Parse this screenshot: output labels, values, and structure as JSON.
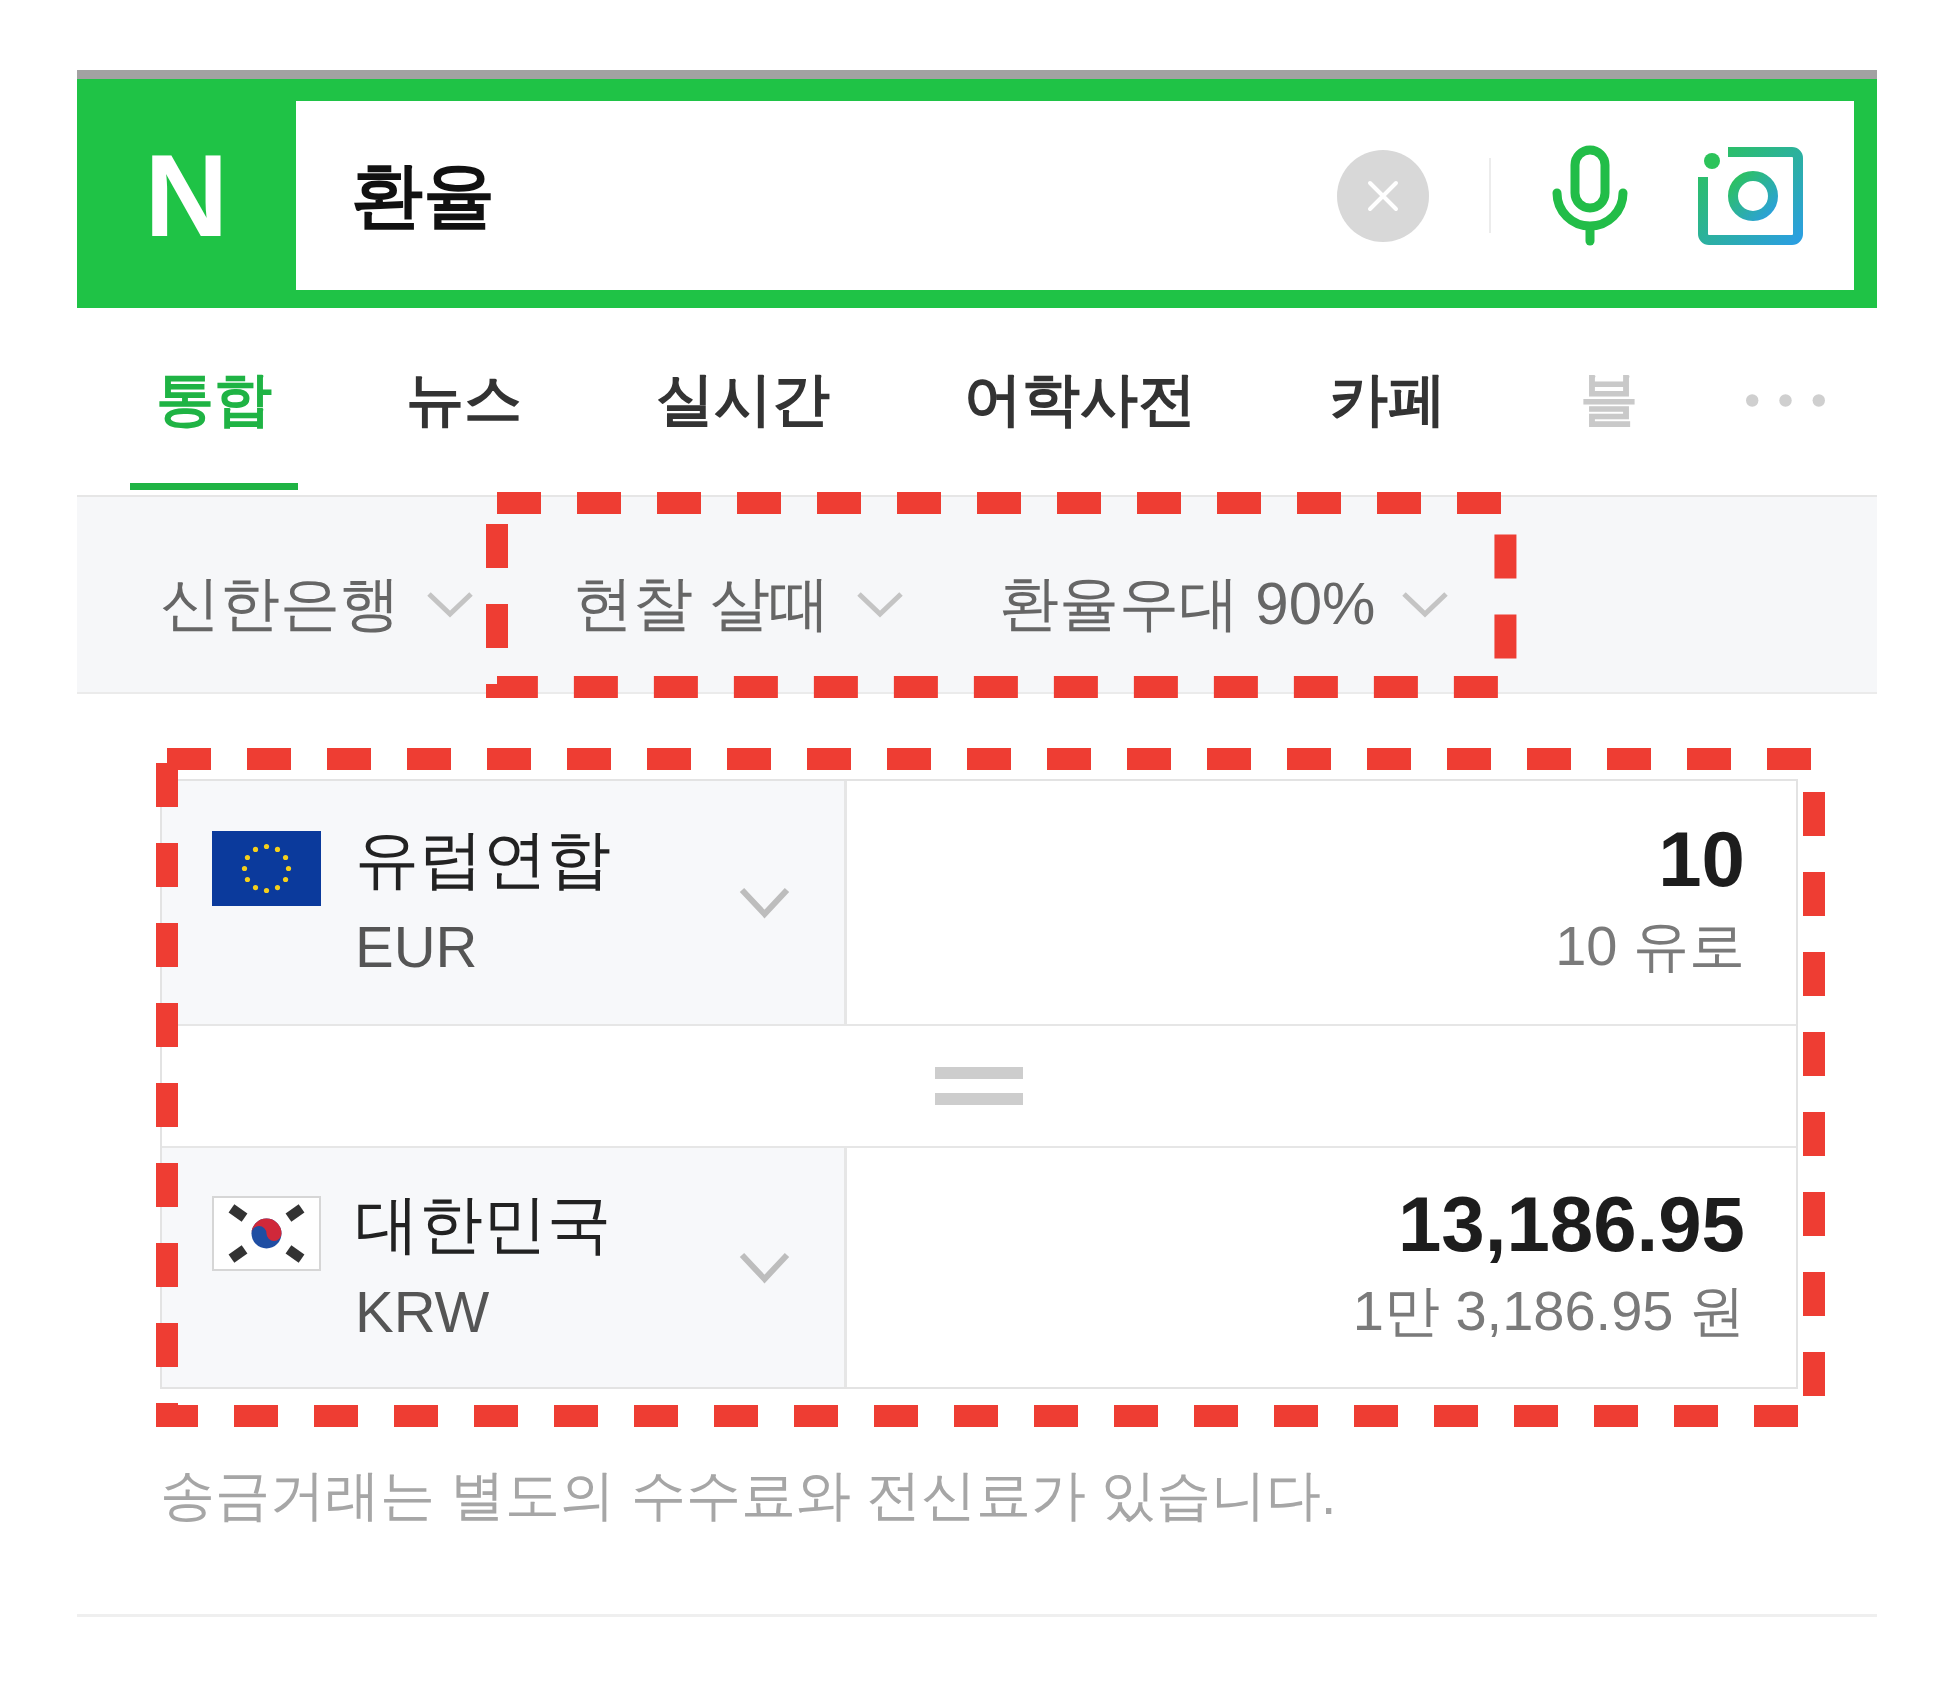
{
  "search": {
    "logo": "N",
    "query": "환율"
  },
  "tabs": [
    {
      "label": "통합",
      "selected": true,
      "faded": false
    },
    {
      "label": "뉴스",
      "selected": false,
      "faded": false
    },
    {
      "label": "실시간",
      "selected": false,
      "faded": false
    },
    {
      "label": "어학사전",
      "selected": false,
      "faded": false
    },
    {
      "label": "카페",
      "selected": false,
      "faded": false
    },
    {
      "label": "블",
      "selected": false,
      "faded": true
    }
  ],
  "filters": [
    {
      "label": "신한은행",
      "highlighted": false
    },
    {
      "label": "현찰 살때",
      "highlighted": true
    },
    {
      "label": "환율우대 90%",
      "highlighted": true
    }
  ],
  "converter": {
    "highlighted": true,
    "rows": [
      {
        "kind": "eu",
        "country": "유럽연합",
        "code": "EUR",
        "amount": "10",
        "amount_in_words": "10 유로"
      },
      {
        "kind": "kr",
        "country": "대한민국",
        "code": "KRW",
        "amount": "13,186.95",
        "amount_in_words": "1만 3,186.95 원"
      }
    ]
  },
  "note": "송금거래는 별도의 수수료와 전신료가 있습니다."
}
